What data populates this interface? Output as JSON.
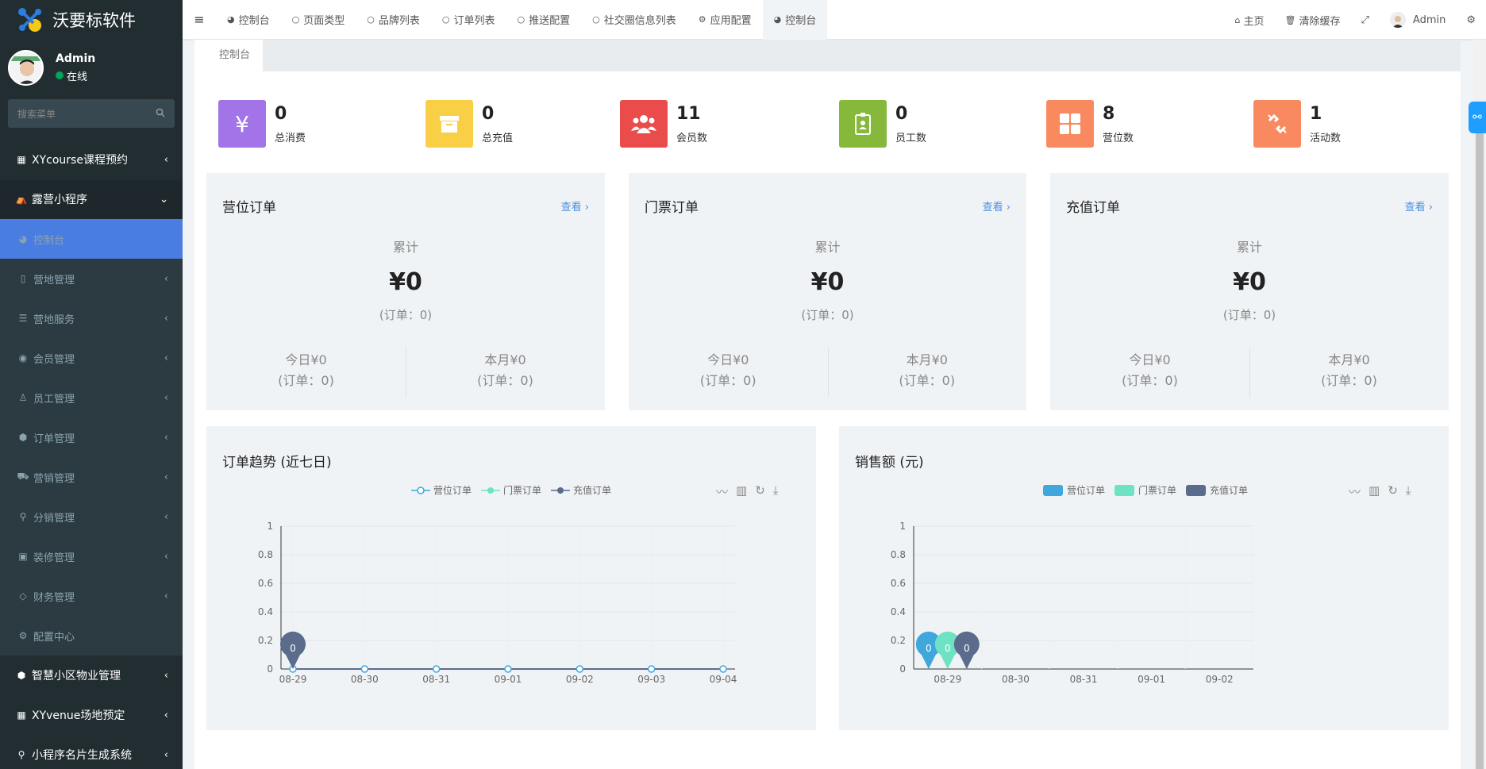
{
  "app": {
    "name": "沃要标软件"
  },
  "user": {
    "name": "Admin",
    "status": "在线"
  },
  "search": {
    "placeholder": "搜索菜单"
  },
  "sidebar": {
    "items": [
      {
        "label": "XYcourse课程预约",
        "icon": "grid-icon"
      },
      {
        "label": "露营小程序",
        "icon": "camp-icon"
      },
      {
        "label": "控制台",
        "icon": "dashboard-icon"
      },
      {
        "label": "营地管理",
        "icon": "map-icon"
      },
      {
        "label": "营地服务",
        "icon": "server-icon"
      },
      {
        "label": "会员管理",
        "icon": "user-circle-icon"
      },
      {
        "label": "员工管理",
        "icon": "user-icon"
      },
      {
        "label": "订单管理",
        "icon": "cube-icon"
      },
      {
        "label": "营销管理",
        "icon": "cart-icon"
      },
      {
        "label": "分销管理",
        "icon": "sitemap-icon"
      },
      {
        "label": "装修管理",
        "icon": "image-icon"
      },
      {
        "label": "财务管理",
        "icon": "diamond-icon"
      },
      {
        "label": "配置中心",
        "icon": "gear-icon"
      },
      {
        "label": "智慧小区物业管理",
        "icon": "cubes-icon"
      },
      {
        "label": "XYvenue场地预定",
        "icon": "grid-icon"
      },
      {
        "label": "小程序名片生成系统",
        "icon": "pin-icon"
      }
    ]
  },
  "navbar": {
    "tabs": [
      {
        "label": "控制台",
        "icon": "dashboard-icon"
      },
      {
        "label": "页面类型",
        "icon": "circle-icon"
      },
      {
        "label": "品牌列表",
        "icon": "circle-icon"
      },
      {
        "label": "订单列表",
        "icon": "circle-icon"
      },
      {
        "label": "推送配置",
        "icon": "circle-icon"
      },
      {
        "label": "社交圈信息列表",
        "icon": "circle-icon"
      },
      {
        "label": "应用配置",
        "icon": "gear-icon"
      },
      {
        "label": "控制台",
        "icon": "dashboard-icon"
      }
    ],
    "home": "主页",
    "clear_cache": "清除缓存",
    "user": "Admin"
  },
  "breadcrumb": {
    "label": "控制台"
  },
  "stats": [
    {
      "value": "0",
      "label": "总消费",
      "color": "#a374e8",
      "icon": "yen-icon"
    },
    {
      "value": "0",
      "label": "总充值",
      "color": "#f8cf45",
      "icon": "archive-icon"
    },
    {
      "value": "11",
      "label": "会员数",
      "color": "#ea4b4b",
      "icon": "users-icon"
    },
    {
      "value": "0",
      "label": "员工数",
      "color": "#86b83c",
      "icon": "badge-icon"
    },
    {
      "value": "8",
      "label": "营位数",
      "color": "#f98a5f",
      "icon": "grid-icon"
    },
    {
      "value": "1",
      "label": "活动数",
      "color": "#f98a5f",
      "icon": "unlink-icon"
    }
  ],
  "panels": [
    {
      "title": "营位订单",
      "link": "查看 ›",
      "total_label": "累计",
      "total": "¥0",
      "total_orders": "(订单：0)",
      "today": "今日¥0",
      "today_orders": "(订单：0)",
      "month": "本月¥0",
      "month_orders": "(订单：0)"
    },
    {
      "title": "门票订单",
      "link": "查看 ›",
      "total_label": "累计",
      "total": "¥0",
      "total_orders": "(订单：0)",
      "today": "今日¥0",
      "today_orders": "(订单：0)",
      "month": "本月¥0",
      "month_orders": "(订单：0)"
    },
    {
      "title": "充值订单",
      "link": "查看 ›",
      "total_label": "累计",
      "total": "¥0",
      "total_orders": "(订单：0)",
      "today": "今日¥0",
      "today_orders": "(订单：0)",
      "month": "本月¥0",
      "month_orders": "(订单：0)"
    }
  ],
  "colors": {
    "series1": "#3fa7dc",
    "series2": "#6ee3c4",
    "series3": "#5b6b8c",
    "accent": "#4a7de0"
  },
  "chart_data": [
    {
      "type": "line",
      "title": "订单趋势 (近七日)",
      "categories": [
        "08-29",
        "08-30",
        "08-31",
        "09-01",
        "09-02",
        "09-03",
        "09-04"
      ],
      "series": [
        {
          "name": "营位订单",
          "values": [
            0,
            0,
            0,
            0,
            0,
            0,
            0
          ]
        },
        {
          "name": "门票订单",
          "values": [
            0,
            0,
            0,
            0,
            0,
            0,
            0
          ]
        },
        {
          "name": "充值订单",
          "values": [
            0,
            0,
            0,
            0,
            0,
            0,
            0
          ]
        }
      ],
      "y_ticks": [
        "0",
        "0.2",
        "0.4",
        "0.6",
        "0.8",
        "1"
      ],
      "ylim": [
        0,
        1
      ],
      "markers": [
        "0"
      ],
      "grid": true,
      "legend": "top-center"
    },
    {
      "type": "bar",
      "title": "销售额 (元)",
      "categories": [
        "08-29",
        "08-30",
        "08-31",
        "09-01",
        "09-02"
      ],
      "series": [
        {
          "name": "营位订单",
          "values": [
            0
          ]
        },
        {
          "name": "门票订单",
          "values": [
            0
          ]
        },
        {
          "name": "充值订单",
          "values": [
            0
          ]
        }
      ],
      "y_ticks": [
        "0",
        "0.2",
        "0.4",
        "0.6",
        "0.8",
        "1"
      ],
      "ylim": [
        0,
        1
      ],
      "markers": [
        "0",
        "0",
        "0"
      ],
      "grid": true,
      "legend": "top-center"
    }
  ]
}
